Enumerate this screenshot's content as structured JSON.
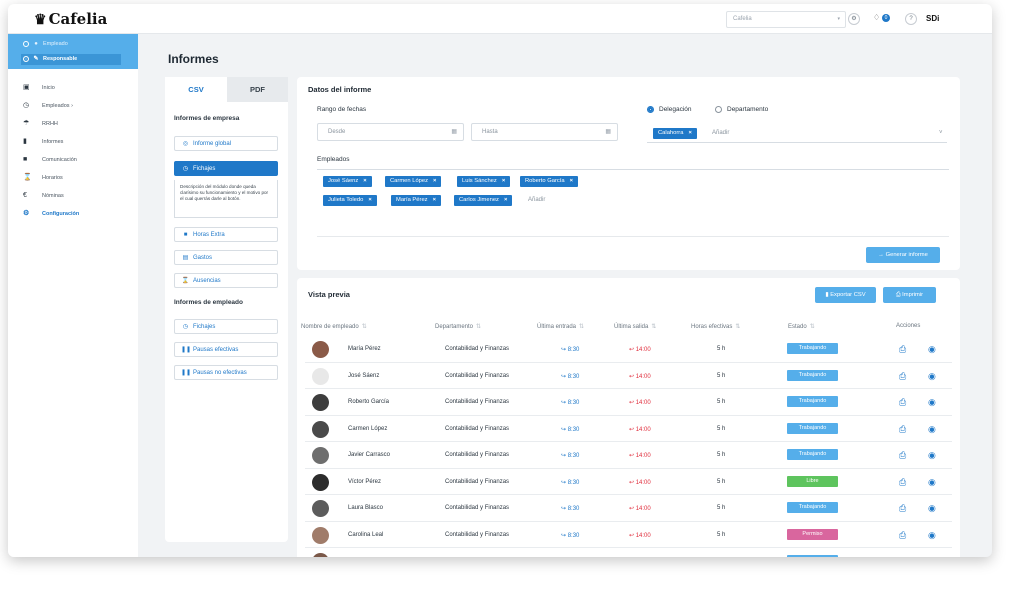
{
  "topbar": {
    "logo": "Cafelia",
    "company_placeholder": "Cafelia",
    "notifications_count": "0",
    "user_initials": "SDi"
  },
  "sidebar": {
    "roles": [
      {
        "label": "Empleado",
        "icon": "user-icon"
      },
      {
        "label": "Responsable",
        "icon": "edit-icon"
      }
    ],
    "items": [
      {
        "label": "Inicio",
        "icon": "home-icon"
      },
      {
        "label": "Empleados",
        "icon": "clock-icon"
      },
      {
        "label": "RRHH",
        "icon": "umbrella-icon"
      },
      {
        "label": "Informes",
        "icon": "thermometer-icon"
      },
      {
        "label": "Comunicación",
        "icon": "car-icon"
      },
      {
        "label": "Horarios",
        "icon": "hourglass-icon"
      },
      {
        "label": "Nóminas",
        "icon": "euro-icon"
      },
      {
        "label": "Configuración",
        "icon": "gear-icon"
      }
    ]
  },
  "page": {
    "title": "Informes"
  },
  "left_panel": {
    "tabs": {
      "csv": "CSV",
      "pdf": "PDF"
    },
    "company_title": "Informes de empresa",
    "company_reports": [
      "Informe global",
      "Fichajes",
      "Horas Extra",
      "Gastos",
      "Ausencias"
    ],
    "fichajes_description": "Descripción del módulo donde queda clarísimo su funcionamiento y el motivo por el cual querrás darle al botón.",
    "employee_title": "Informes de empleado",
    "employee_reports": [
      "Fichajes",
      "Pausas efectivas",
      "Pausas no efectivas"
    ]
  },
  "datos": {
    "title": "Datos del informe",
    "date_range_label": "Rango de fechas",
    "from_placeholder": "Desde",
    "to_placeholder": "Hasta",
    "radio_delegacion": "Delegación",
    "radio_departamento": "Departamento",
    "delegaciones": [
      "Calahorra"
    ],
    "add_placeholder": "Añadir",
    "employees_label": "Empleados",
    "employees": [
      "José Sáenz",
      "Carmen López",
      "Luis Sánchez",
      "Roberto García",
      "Julieta Toledo",
      "María Pérez",
      "Carlos Jimenez"
    ],
    "generate_label": "Generar informe"
  },
  "preview": {
    "title": "Vista previa",
    "export_label": "Exportar CSV",
    "print_label": "Imprimir",
    "headers": [
      "Nombre de empleado",
      "Departamento",
      "Última entrada",
      "Última salida",
      "Horas efectivas",
      "Estado",
      "Acciones"
    ],
    "rows": [
      {
        "name": "María Pérez",
        "dept": "Contabilidad y Finanzas",
        "in": "8:30",
        "out": "14:00",
        "hours": "5 h",
        "status": "Trabajando"
      },
      {
        "name": "José Sáenz",
        "dept": "Contabilidad y Finanzas",
        "in": "8:30",
        "out": "14:00",
        "hours": "5 h",
        "status": "Trabajando"
      },
      {
        "name": "Roberto García",
        "dept": "Contabilidad y Finanzas",
        "in": "8:30",
        "out": "14:00",
        "hours": "5 h",
        "status": "Trabajando"
      },
      {
        "name": "Carmen López",
        "dept": "Contabilidad y Finanzas",
        "in": "8:30",
        "out": "14:00",
        "hours": "5 h",
        "status": "Trabajando"
      },
      {
        "name": "Javier Carrasco",
        "dept": "Contabilidad y Finanzas",
        "in": "8:30",
        "out": "14:00",
        "hours": "5 h",
        "status": "Trabajando"
      },
      {
        "name": "Víctor Pérez",
        "dept": "Contabilidad y Finanzas",
        "in": "8:30",
        "out": "14:00",
        "hours": "5 h",
        "status": "Libre"
      },
      {
        "name": "Laura Blasco",
        "dept": "Contabilidad y Finanzas",
        "in": "8:30",
        "out": "14:00",
        "hours": "5 h",
        "status": "Trabajando"
      },
      {
        "name": "Carolina Leal",
        "dept": "Contabilidad y Finanzas",
        "in": "8:30",
        "out": "14:00",
        "hours": "5 h",
        "status": "Permiso"
      },
      {
        "name": "",
        "dept": "",
        "in": "8:30",
        "out": "14:00",
        "hours": "5 h",
        "status": "Trabajando"
      }
    ],
    "status_colors": {
      "Trabajando": "#55aeea",
      "Libre": "#5ec45e",
      "Permiso": "#d9669e"
    }
  },
  "colors": {
    "accent": "#1f78c8",
    "accent_light": "#55aeea",
    "danger": "#e02d3c"
  }
}
